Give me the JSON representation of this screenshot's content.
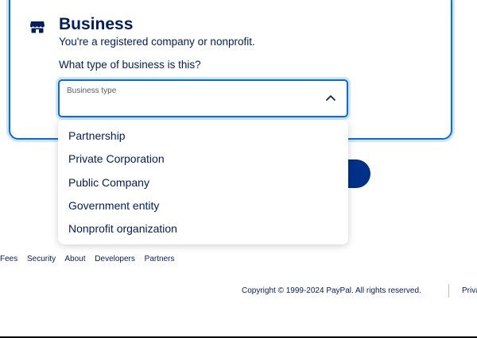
{
  "business_card": {
    "title": "Business",
    "description": "You're a registered company or nonprofit.",
    "question": "What type of business is this?",
    "icon": "store-icon"
  },
  "business_type_select": {
    "label": "Business type",
    "value": "",
    "expanded": true
  },
  "dropdown": {
    "options": [
      "Partnership",
      "Private Corporation",
      "Public Company",
      "Government entity",
      "Nonprofit organization"
    ]
  },
  "footer": {
    "links": [
      "Fees",
      "Security",
      "About",
      "Developers",
      "Partners"
    ],
    "copyright": "Copyright © 1999-2024 PayPal. All rights reserved.",
    "privacy": "Priva"
  },
  "colors": {
    "accent": "#0070e0",
    "focus_ring": "#d1e4fb",
    "text": "#001c64",
    "button": "#003087"
  }
}
